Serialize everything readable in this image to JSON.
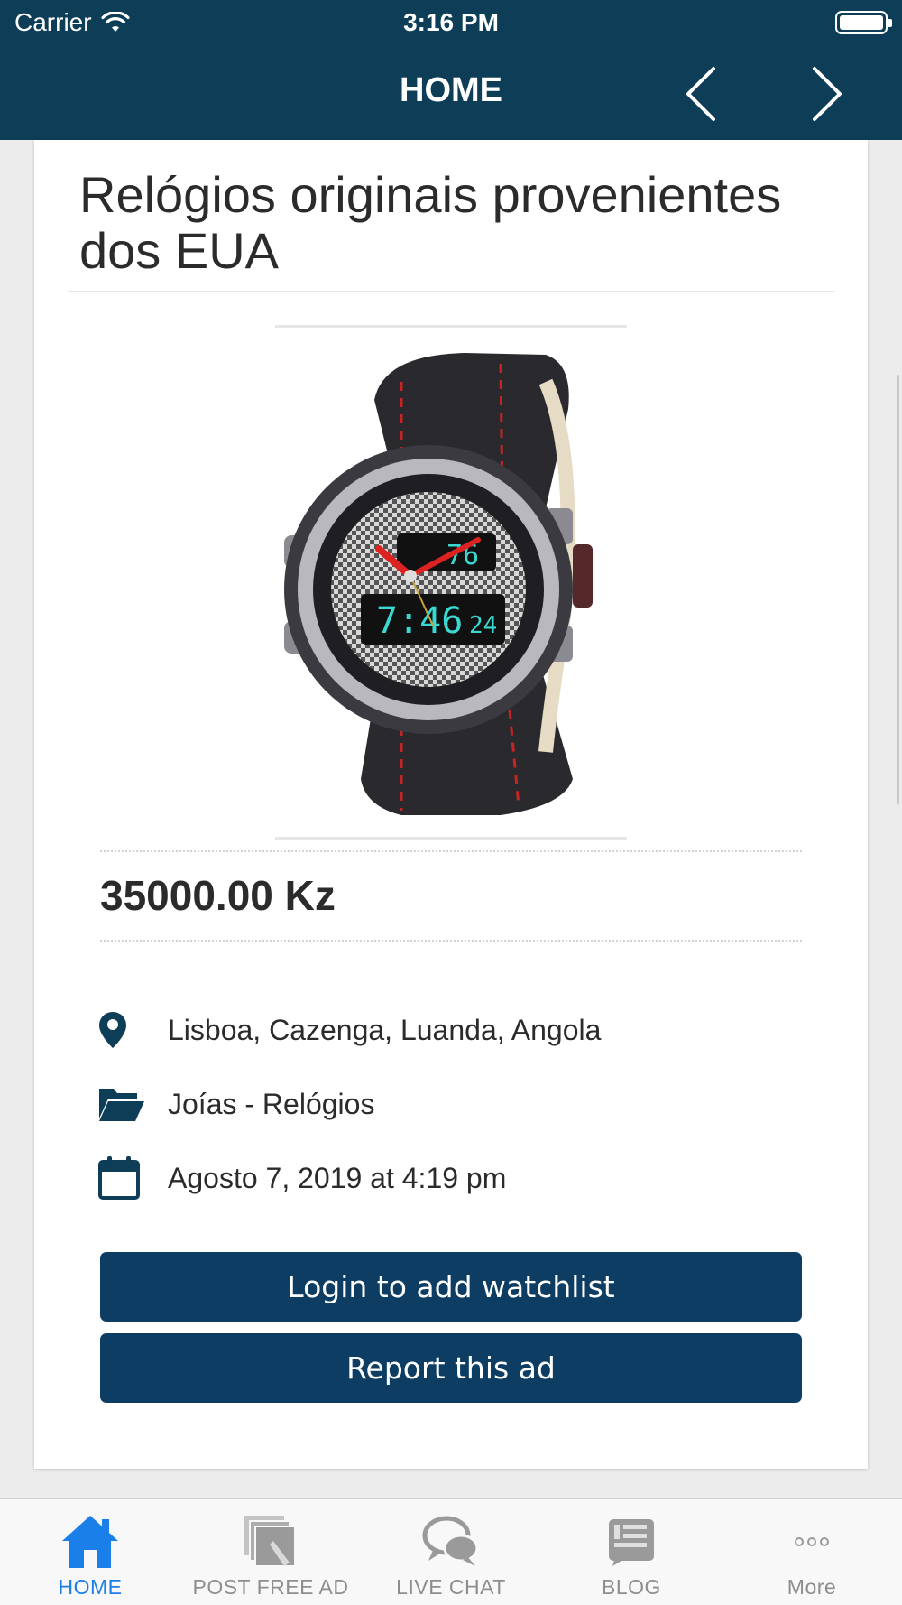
{
  "status_bar": {
    "carrier": "Carrier",
    "time": "3:16 PM"
  },
  "nav": {
    "title": "HOME",
    "prev_icon": "chevron-left-icon",
    "next_icon": "chevron-right-icon"
  },
  "ad": {
    "title": "Relógios originais provenientes dos EUA",
    "image": "watch-photo",
    "price": "35000.00 Kz",
    "location": "Lisboa, Cazenga, Luanda, Angola",
    "category": "Joías - Relógios",
    "date": "Agosto 7, 2019 at 4:19 pm",
    "location_icon": "map-pin-icon",
    "category_icon": "folder-open-icon",
    "date_icon": "calendar-icon"
  },
  "buttons": {
    "watchlist": "Login to add watchlist",
    "report": "Report this ad"
  },
  "tabs": [
    {
      "label": "HOME",
      "icon": "home-icon",
      "active": true
    },
    {
      "label": "POST FREE AD",
      "icon": "post-ad-icon",
      "active": false
    },
    {
      "label": "LIVE CHAT",
      "icon": "chat-bubbles-icon",
      "active": false
    },
    {
      "label": "BLOG",
      "icon": "blog-icon",
      "active": false
    },
    {
      "label": "More",
      "icon": "more-dots-icon",
      "active": false
    }
  ],
  "colors": {
    "header": "#0d3d57",
    "button": "#0d3d62",
    "active_tab": "#1a7fe8",
    "inactive_tab": "#8e8e8e"
  }
}
